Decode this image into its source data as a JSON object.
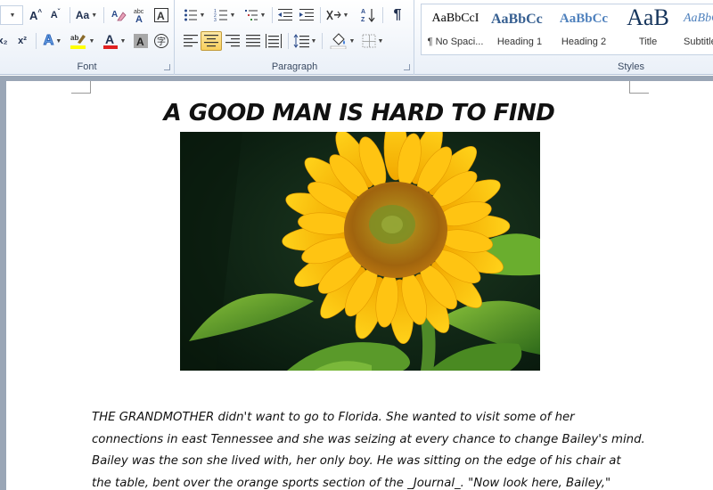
{
  "ribbon": {
    "font_group": {
      "label": "Font",
      "grow_font_label": "A",
      "shrink_font_label": "A",
      "change_case_label": "Aa",
      "subscript_label": "x₂",
      "superscript_label": "x²",
      "text_effects_label": "A",
      "font_color_label": "A",
      "char_shading_label": "A",
      "enclose_label": "字",
      "highlight_color": "#ffff00",
      "font_color": "#e02020"
    },
    "paragraph_group": {
      "label": "Paragraph",
      "show_marks_label": "¶"
    },
    "styles_group": {
      "label": "Styles",
      "items": [
        {
          "sample": "AaBbCcI",
          "name": "¶ No Spaci..."
        },
        {
          "sample": "AaBbCc",
          "name": "Heading 1"
        },
        {
          "sample": "AaBbCc",
          "name": "Heading 2"
        },
        {
          "sample": "AaB",
          "name": "Title"
        },
        {
          "sample": "AaBbCc",
          "name": "Subtitle"
        }
      ]
    }
  },
  "document": {
    "title": "A GOOD MAN IS HARD TO FIND",
    "image_subject": "sunflower",
    "lines": [
      "THE GRANDMOTHER  didn't want to go to Florida. She wanted to visit some of her",
      "connections in east Tennessee  and she was seizing at every chance to change Bailey's mind.",
      "Bailey was the son she lived with, her only boy. He was sitting on the edge of his chair at",
      "the table, bent over the orange sports section of the _Journal_. \"Now look here, Bailey,\""
    ]
  }
}
